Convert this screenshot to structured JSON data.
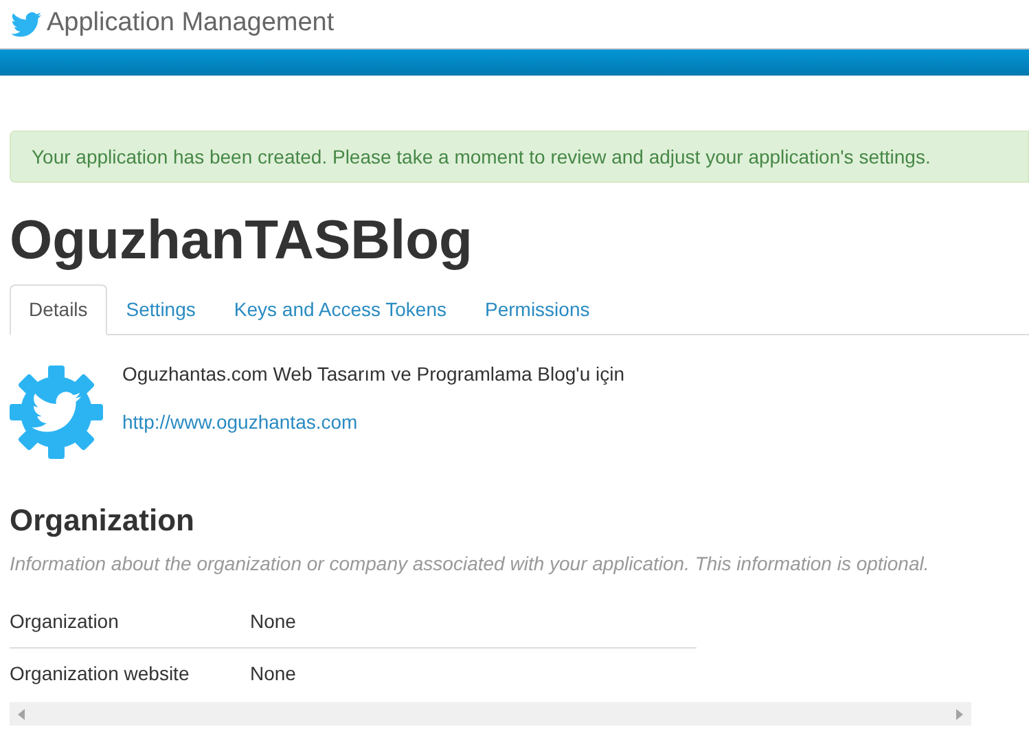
{
  "header": {
    "title": "Application Management"
  },
  "alert": {
    "message": "Your application has been created. Please take a moment to review and adjust your application's settings."
  },
  "app": {
    "name": "OguzhanTASBlog",
    "description": "Oguzhantas.com Web Tasarım ve Programlama Blog'u için",
    "url": "http://www.oguzhantas.com"
  },
  "tabs": [
    {
      "label": "Details",
      "selected": true
    },
    {
      "label": "Settings",
      "selected": false
    },
    {
      "label": "Keys and Access Tokens",
      "selected": false
    },
    {
      "label": "Permissions",
      "selected": false
    }
  ],
  "organization": {
    "heading": "Organization",
    "note": "Information about the organization or company associated with your application. This information is optional.",
    "rows": [
      {
        "label": "Organization",
        "value": "None"
      },
      {
        "label": "Organization website",
        "value": "None"
      }
    ]
  }
}
